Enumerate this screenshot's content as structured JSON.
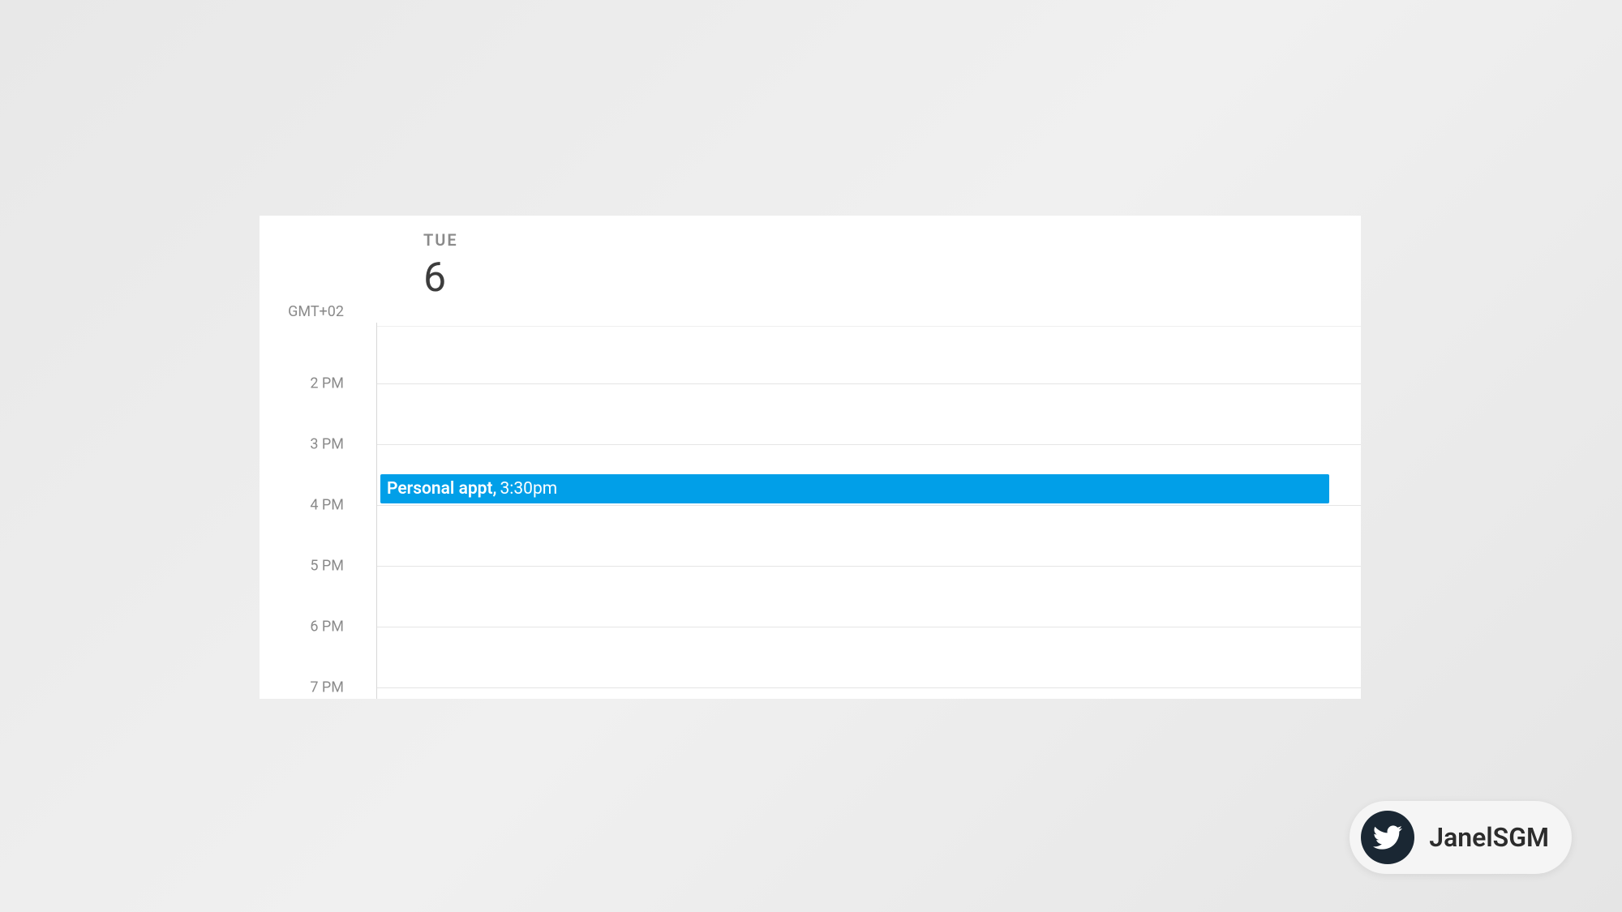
{
  "calendar": {
    "day_name": "TUE",
    "day_number": "6",
    "timezone": "GMT+02",
    "hours": [
      "2 PM",
      "3 PM",
      "4 PM",
      "5 PM",
      "6 PM",
      "7 PM"
    ],
    "event": {
      "title": "Personal appt,",
      "time": "3:30pm",
      "color": "#019fe8"
    }
  },
  "attribution": {
    "handle": "JanelSGM"
  }
}
